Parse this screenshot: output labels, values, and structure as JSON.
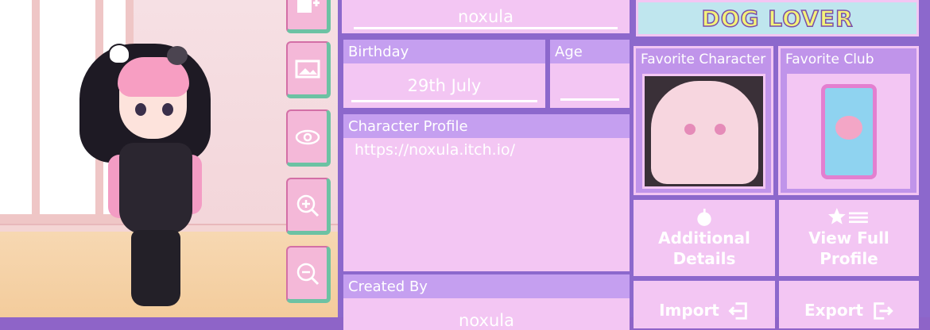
{
  "profile": {
    "name": "noxula",
    "birthday_label": "Birthday",
    "birthday_value": "29th July",
    "age_label": "Age",
    "age_value": "",
    "character_profile_label": "Character Profile",
    "character_profile_value": "https://noxula.itch.io/",
    "created_by_label": "Created By",
    "created_by_value": "noxula"
  },
  "banner": {
    "text": "DOG LOVER"
  },
  "favorites": {
    "character_label": "Favorite Character",
    "club_label": "Favorite Club"
  },
  "actions": {
    "additional_line1": "Additional",
    "additional_line2": "Details",
    "view_line1": "View Full",
    "view_line2": "Profile",
    "import": "Import",
    "export": "Export"
  },
  "tools": [
    "add-character-icon",
    "image-icon",
    "eye-icon",
    "zoom-in-icon",
    "zoom-out-icon"
  ],
  "colors": {
    "panel": "#8c68cc",
    "label": "#c59ff0",
    "field": "#f3c6f3",
    "tool": "#f4b8d8"
  }
}
